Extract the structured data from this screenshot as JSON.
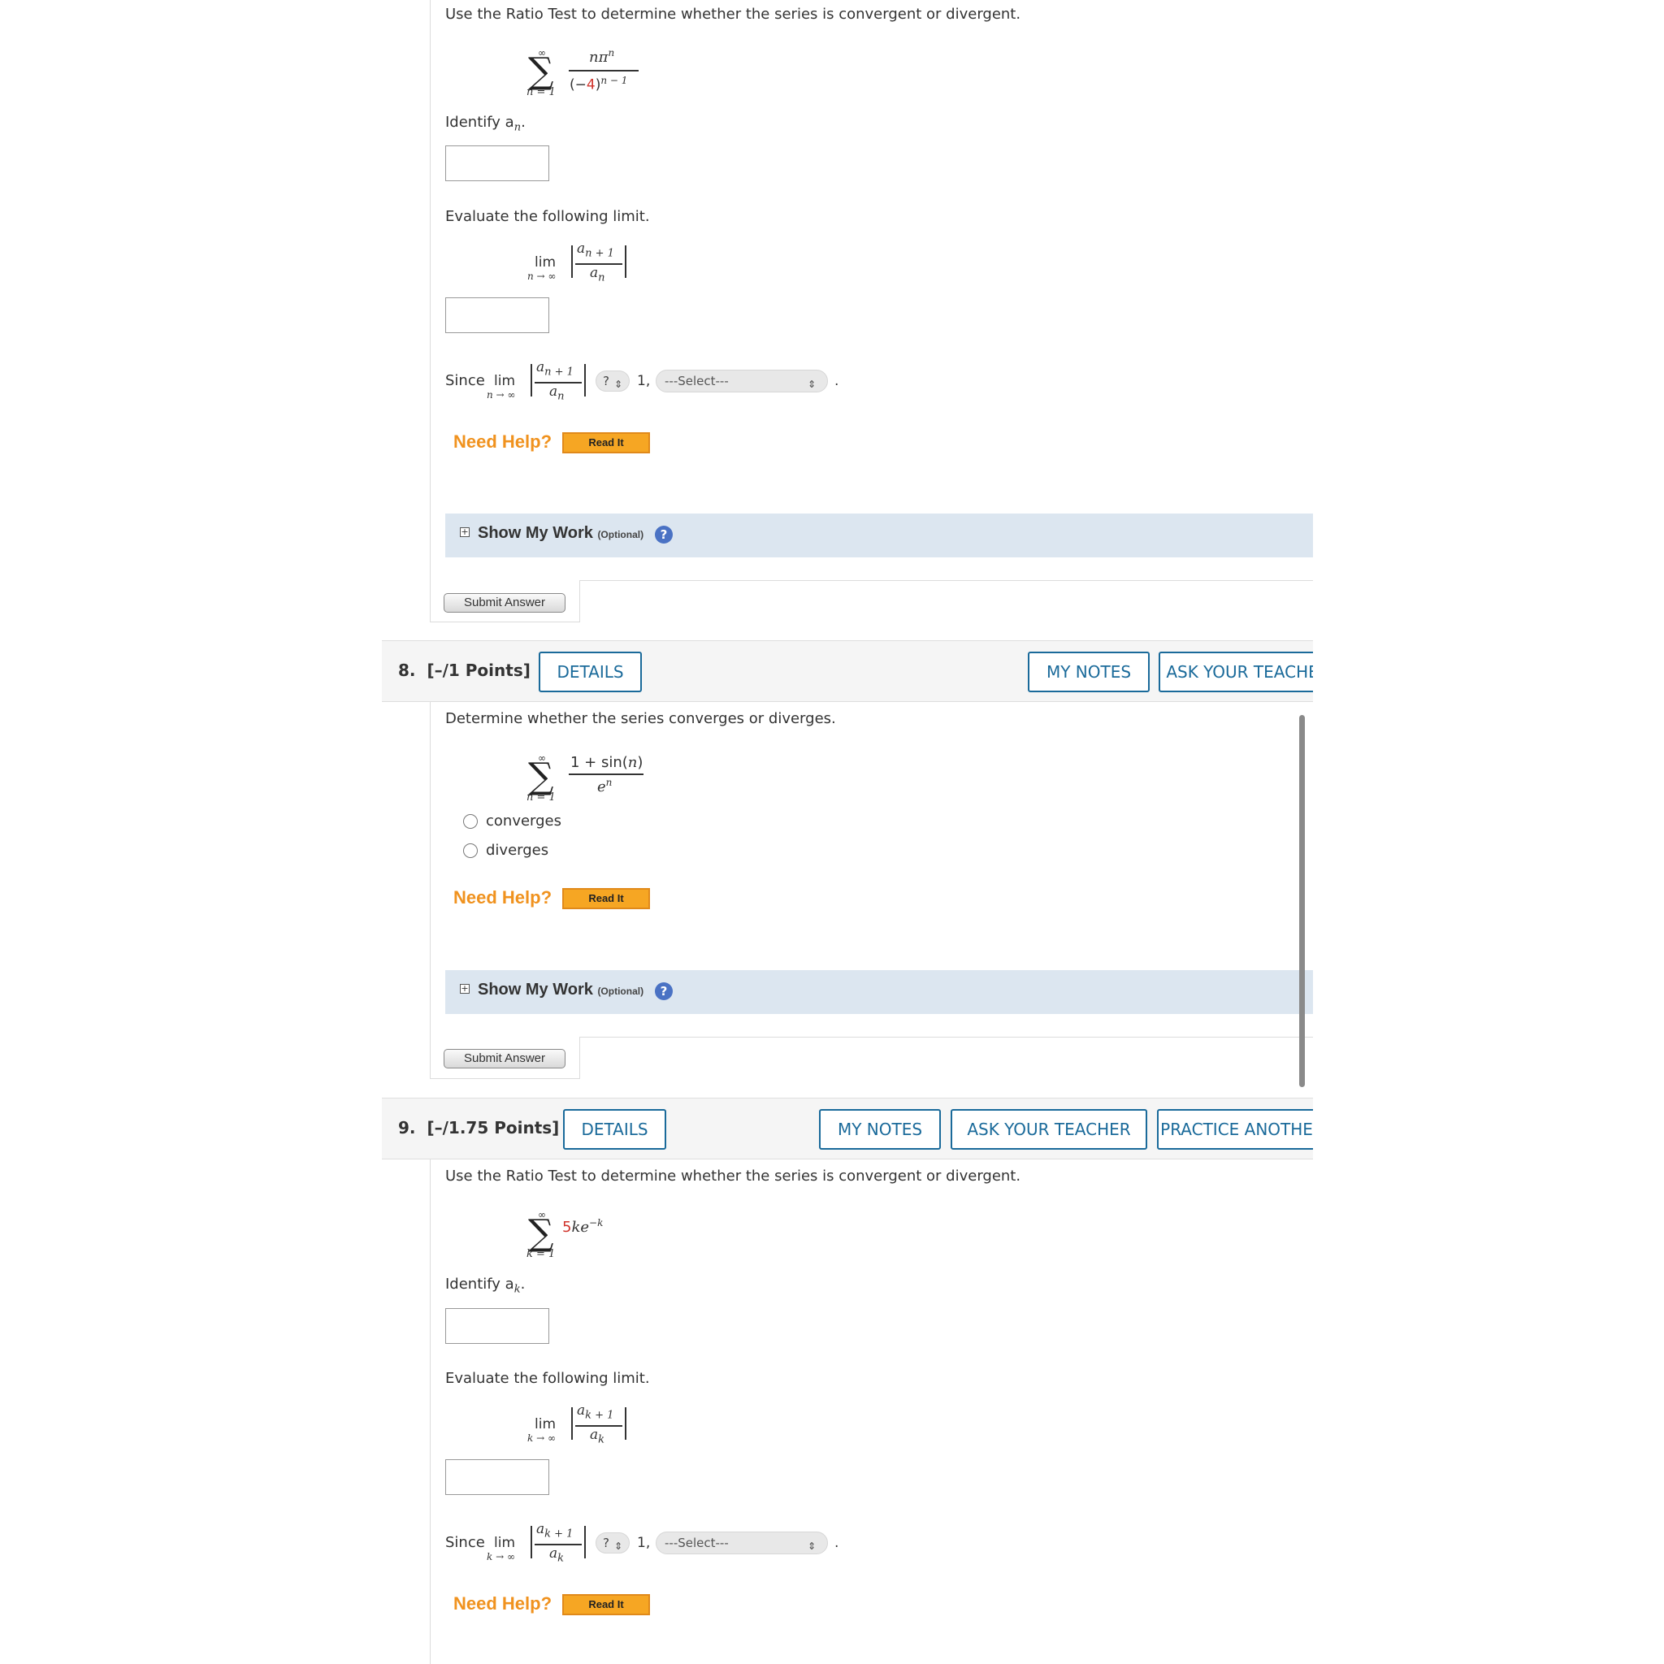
{
  "question7": {
    "prompt": "Use the Ratio Test to determine whether the series is convergent or divergent.",
    "series": {
      "upper": "∞",
      "lower": "n = 1",
      "numerator": "nπ",
      "numerator_exp": "n",
      "denominator_prefix": "(−",
      "denominator_red": "4",
      "denominator_suffix": ")",
      "denominator_exp": "n − 1"
    },
    "identify_label": "Identify a",
    "identify_sub": "n",
    "identify_end": ".",
    "evaluate_label": "Evaluate the following limit.",
    "limit": {
      "lim": "lim",
      "under": "n → ∞",
      "top": "a",
      "top_sub": "n + 1",
      "bottom": "a",
      "bottom_sub": "n"
    },
    "since_label": "Since",
    "compare_value": "?",
    "compare_number": "1,",
    "select_value": "---Select---",
    "period": ".",
    "need_help": "Need Help?",
    "read_it": "Read It",
    "show_my_work": "Show My Work",
    "optional": "(Optional)",
    "help_icon_text": "?",
    "submit": "Submit Answer"
  },
  "question8": {
    "number": "8.",
    "points": "[–/1 Points]",
    "details": "DETAILS",
    "my_notes": "MY NOTES",
    "ask_teacher": "ASK YOUR TEACHER",
    "prompt": "Determine whether the series converges or diverges.",
    "series": {
      "upper": "∞",
      "lower": "n = 1",
      "numerator_pre": "1 + sin(",
      "numerator_var": "n",
      "numerator_post": ")",
      "denominator": "e",
      "denominator_exp": "n"
    },
    "options": [
      "converges",
      "diverges"
    ],
    "need_help": "Need Help?",
    "read_it": "Read It",
    "show_my_work": "Show My Work",
    "optional": "(Optional)",
    "help_icon_text": "?",
    "submit": "Submit Answer"
  },
  "question9": {
    "number": "9.",
    "points": "[–/1.75 Points]",
    "details": "DETAILS",
    "my_notes": "MY NOTES",
    "ask_teacher": "ASK YOUR TEACHER",
    "practice_another": "PRACTICE ANOTHER",
    "prompt": "Use the Ratio Test to determine whether the series is convergent or divergent.",
    "series": {
      "upper": "∞",
      "lower": "k = 1",
      "coef_red": "5",
      "term": "ke",
      "term_exp": "−k"
    },
    "identify_label": "Identify a",
    "identify_sub": "k",
    "identify_end": ".",
    "evaluate_label": "Evaluate the following limit.",
    "limit": {
      "lim": "lim",
      "under": "k → ∞",
      "top": "a",
      "top_sub": "k + 1",
      "bottom": "a",
      "bottom_sub": "k"
    },
    "since_label": "Since",
    "compare_value": "?",
    "compare_number": "1,",
    "select_value": "---Select---",
    "period": ".",
    "need_help": "Need Help?",
    "read_it": "Read It"
  }
}
